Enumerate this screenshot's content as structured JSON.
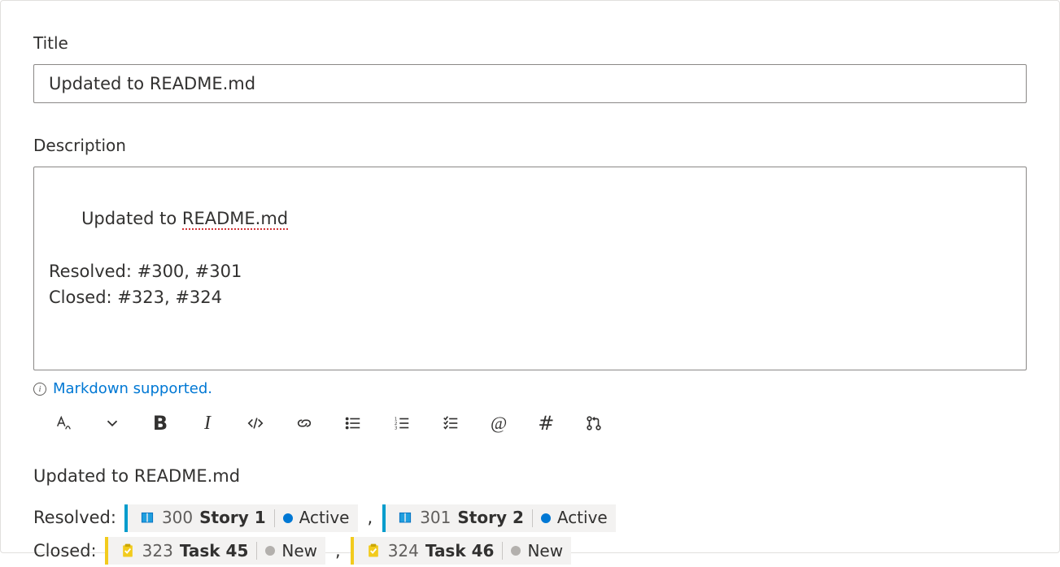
{
  "fields": {
    "title_label": "Title",
    "title_value": "Updated to README.md",
    "description_label": "Description",
    "description_line1_prefix": "Updated to ",
    "description_line1_spellcheck": "README.md",
    "description_line3": "Resolved: #300, #301",
    "description_line4": "Closed: #323, #324"
  },
  "markdown_hint": "Markdown supported.",
  "preview": {
    "title": "Updated to README.md",
    "rows": [
      {
        "label": "Resolved:",
        "stripe": "blue",
        "icon": "book",
        "items": [
          {
            "id": "300",
            "name": "Story 1",
            "state": "Active",
            "dot": "active"
          },
          {
            "id": "301",
            "name": "Story 2",
            "state": "Active",
            "dot": "active"
          }
        ]
      },
      {
        "label": "Closed:",
        "stripe": "yellow",
        "icon": "clipboard",
        "items": [
          {
            "id": "323",
            "name": "Task 45",
            "state": "New",
            "dot": "new"
          },
          {
            "id": "324",
            "name": "Task 46",
            "state": "New",
            "dot": "new"
          }
        ]
      }
    ]
  },
  "separator": ","
}
